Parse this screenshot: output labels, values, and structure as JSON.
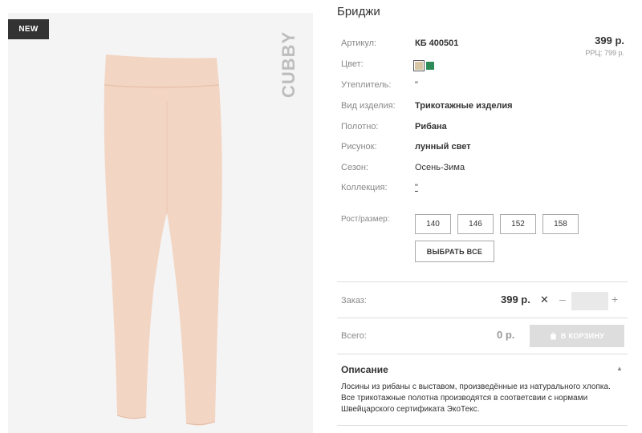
{
  "badge": "NEW",
  "brand": "CUBBY",
  "product": {
    "title": "Бриджи",
    "price": "399 р.",
    "rrp": "РРЦ: 799 р."
  },
  "specs": [
    {
      "label": "Артикул:",
      "value": "КБ 400501"
    },
    {
      "label": "Цвет:",
      "value": ""
    },
    {
      "label": "Утеплитель:",
      "value": "\""
    },
    {
      "label": "Вид изделия:",
      "value": "Трикотажные изделия"
    },
    {
      "label": "Полотно:",
      "value": "Рибана"
    },
    {
      "label": "Рисунок:",
      "value": "лунный свет"
    },
    {
      "label": "Сезон:",
      "value": "Осень-Зима"
    },
    {
      "label": "Коллекция:",
      "value": "\""
    }
  ],
  "colors": {
    "selected": "#d9c6a5",
    "other": "#2e8b57"
  },
  "sizes": {
    "label": "Рост/размер:",
    "options": [
      "140",
      "146",
      "152",
      "158"
    ],
    "select_all": "ВЫБРАТЬ ВСЕ"
  },
  "order": {
    "label": "Заказ:",
    "price": "399 р.",
    "times": "✕",
    "minus": "–",
    "plus": "+",
    "quantity": ""
  },
  "total": {
    "label": "Всего:",
    "value": "0 р.",
    "cart_button": "В КОРЗИНУ"
  },
  "description": {
    "title": "Описание",
    "text": "Лосины из рибаны с выставом, произведённые из натурального хлопка. Все трикотажные полотна производятся в соответсвии с нормами Швейцарского сертификата ЭкоТекс."
  }
}
